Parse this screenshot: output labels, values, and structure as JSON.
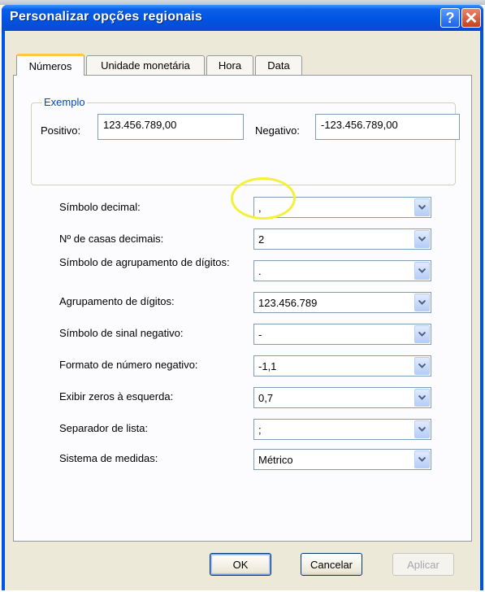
{
  "window": {
    "title": "Personalizar opções regionais",
    "help_glyph": "?",
    "close_glyph": "✕"
  },
  "tabs": [
    {
      "label": "Números",
      "active": true
    },
    {
      "label": "Unidade monetária",
      "active": false
    },
    {
      "label": "Hora",
      "active": false
    },
    {
      "label": "Data",
      "active": false
    }
  ],
  "example": {
    "group_label": "Exemplo",
    "positive_label": "Positivo:",
    "positive_value": "123.456.789,00",
    "negative_label": "Negativo:",
    "negative_value": "-123.456.789,00"
  },
  "settings": [
    {
      "label": "Símbolo decimal:",
      "value": ","
    },
    {
      "label": "Nº de casas decimais:",
      "value": "2"
    },
    {
      "label": "Símbolo de agrupamento de dígitos:",
      "value": "."
    },
    {
      "label": "Agrupamento de dígitos:",
      "value": "123.456.789"
    },
    {
      "label": "Símbolo de sinal negativo:",
      "value": "-"
    },
    {
      "label": "Formato de número negativo:",
      "value": "-1,1"
    },
    {
      "label": "Exibir zeros à esquerda:",
      "value": "0,7"
    },
    {
      "label": "Separador de lista:",
      "value": ";"
    },
    {
      "label": "Sistema de medidas:",
      "value": "Métrico"
    }
  ],
  "buttons": {
    "ok": "OK",
    "cancel": "Cancelar",
    "apply": "Aplicar"
  },
  "colors": {
    "titlebar": "#0054e3",
    "dialog_background": "#ece9d8",
    "group_label": "#0046d5",
    "highlight_circle": "#f3f13a"
  }
}
